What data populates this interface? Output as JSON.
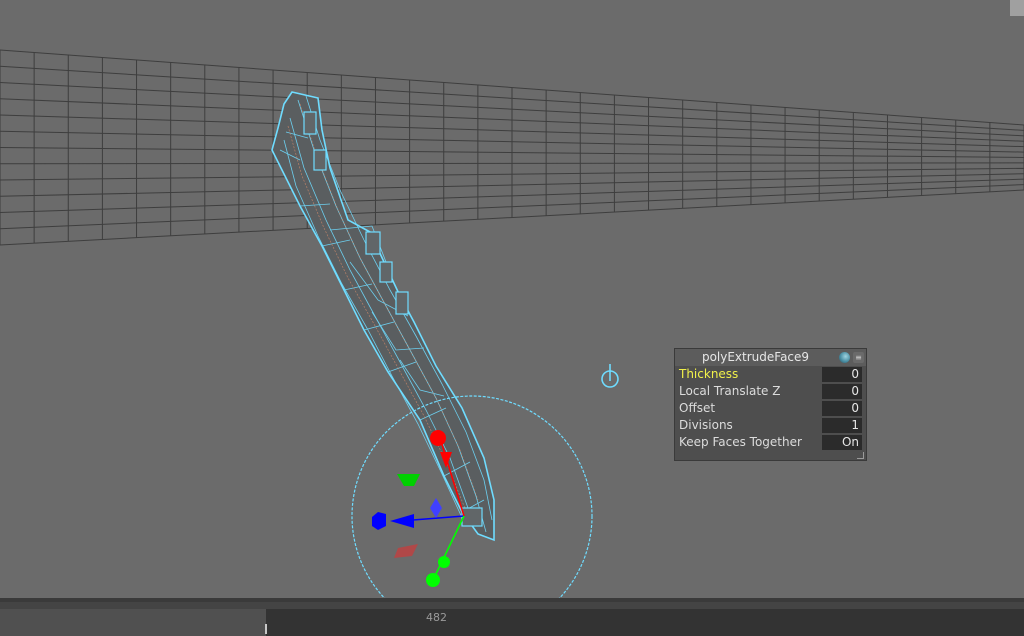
{
  "node_editor": {
    "title": "polyExtrudeFace9",
    "attributes": [
      {
        "label": "Thickness",
        "value": "0",
        "highlighted": true
      },
      {
        "label": "Local Translate Z",
        "value": "0",
        "highlighted": false
      },
      {
        "label": "Offset",
        "value": "0",
        "highlighted": false
      },
      {
        "label": "Divisions",
        "value": "1",
        "highlighted": false
      },
      {
        "label": "Keep Faces Together",
        "value": "On",
        "highlighted": false
      }
    ]
  },
  "timeline": {
    "current_frame": "482"
  },
  "colors": {
    "viewport_bg": "#6b6b6b",
    "wireframe": "#5fd2ff",
    "highlight_label": "#f1f14a",
    "manip_x": "#ff0000",
    "manip_y": "#00ff00",
    "manip_z": "#0000ff"
  }
}
